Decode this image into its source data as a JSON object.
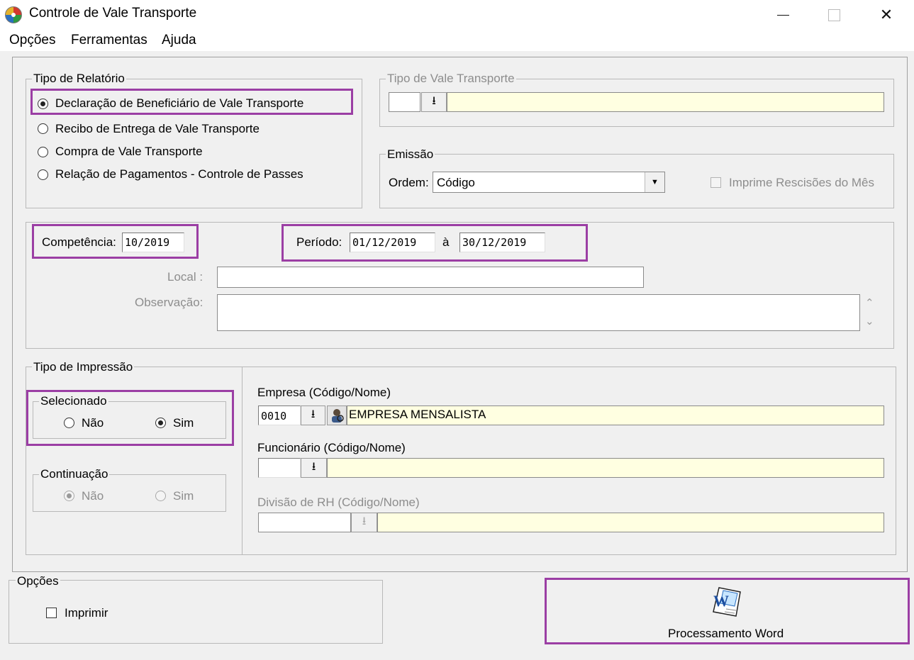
{
  "window": {
    "title": "Controle de Vale Transporte"
  },
  "menu": [
    "Opções",
    "Ferramentas",
    "Ajuda"
  ],
  "tipo_relatorio": {
    "title": "Tipo de Relatório",
    "options": [
      {
        "label": "Declaração de Beneficiário de Vale Transporte",
        "checked": true
      },
      {
        "label": "Recibo de Entrega de Vale Transporte",
        "checked": false
      },
      {
        "label": "Compra de Vale Transporte",
        "checked": false
      },
      {
        "label": "Relação de Pagamentos - Controle de Passes",
        "checked": false
      }
    ]
  },
  "tipo_vale": {
    "title": "Tipo de Vale Transporte",
    "code": "",
    "name": ""
  },
  "emissao": {
    "title": "Emissão",
    "ordem_label": "Ordem:",
    "ordem_value": "Código",
    "rescisoes_label": "Imprime Rescisões do Mês",
    "rescisoes_checked": false
  },
  "competencia": {
    "label": "Competência:",
    "value": "10/2019"
  },
  "periodo": {
    "label": "Período:",
    "start": "01/12/2019",
    "separator": "à",
    "end": "30/12/2019"
  },
  "local": {
    "label": "Local :",
    "value": ""
  },
  "observacao": {
    "label": "Observação:",
    "value": ""
  },
  "tipo_impressao": {
    "title": "Tipo de Impressão",
    "selecionado": {
      "title": "Selecionado",
      "nao": "Não",
      "sim": "Sim",
      "value": "Sim"
    },
    "continuacao": {
      "title": "Continuação",
      "nao": "Não",
      "sim": "Sim",
      "value": "Não"
    }
  },
  "empresa": {
    "label": "Empresa (Código/Nome)",
    "code": "0010",
    "name": "EMPRESA MENSALISTA"
  },
  "funcionario": {
    "label": "Funcionário (Código/Nome)",
    "code": "",
    "name": ""
  },
  "divisao": {
    "label": "Divisão de RH (Código/Nome)",
    "code": "",
    "name": ""
  },
  "opcoes": {
    "title": "Opções",
    "imprimir_label": "Imprimir",
    "imprimir_checked": false
  },
  "process_button": {
    "label": "Processamento Word"
  },
  "colors": {
    "highlight": "#9b3ea4",
    "lookup_field": "#ffffe1"
  },
  "icons": [
    "app-logo-icon",
    "minimize-icon",
    "maximize-icon",
    "close-icon",
    "dropdown-arrow-icon",
    "lookup-arrow-icon",
    "person-search-icon",
    "word-document-icon",
    "scroll-up-icon",
    "scroll-down-icon"
  ]
}
